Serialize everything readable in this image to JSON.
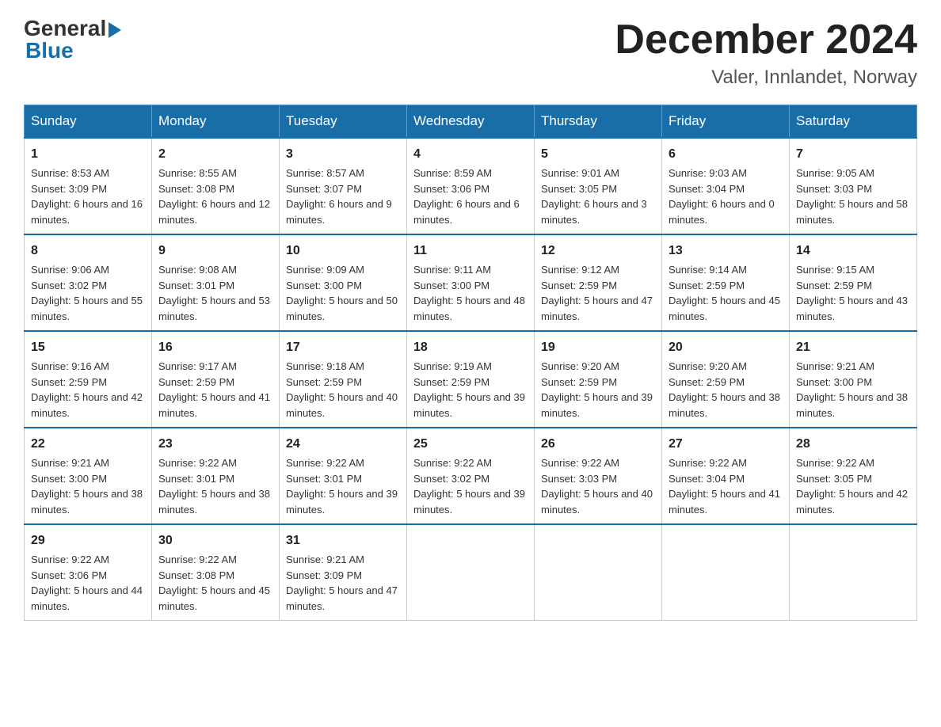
{
  "header": {
    "logo_general": "General",
    "logo_blue": "Blue",
    "month_title": "December 2024",
    "location": "Valer, Innlandet, Norway"
  },
  "days_of_week": [
    "Sunday",
    "Monday",
    "Tuesday",
    "Wednesday",
    "Thursday",
    "Friday",
    "Saturday"
  ],
  "weeks": [
    [
      {
        "day": "1",
        "sunrise": "Sunrise: 8:53 AM",
        "sunset": "Sunset: 3:09 PM",
        "daylight": "Daylight: 6 hours and 16 minutes."
      },
      {
        "day": "2",
        "sunrise": "Sunrise: 8:55 AM",
        "sunset": "Sunset: 3:08 PM",
        "daylight": "Daylight: 6 hours and 12 minutes."
      },
      {
        "day": "3",
        "sunrise": "Sunrise: 8:57 AM",
        "sunset": "Sunset: 3:07 PM",
        "daylight": "Daylight: 6 hours and 9 minutes."
      },
      {
        "day": "4",
        "sunrise": "Sunrise: 8:59 AM",
        "sunset": "Sunset: 3:06 PM",
        "daylight": "Daylight: 6 hours and 6 minutes."
      },
      {
        "day": "5",
        "sunrise": "Sunrise: 9:01 AM",
        "sunset": "Sunset: 3:05 PM",
        "daylight": "Daylight: 6 hours and 3 minutes."
      },
      {
        "day": "6",
        "sunrise": "Sunrise: 9:03 AM",
        "sunset": "Sunset: 3:04 PM",
        "daylight": "Daylight: 6 hours and 0 minutes."
      },
      {
        "day": "7",
        "sunrise": "Sunrise: 9:05 AM",
        "sunset": "Sunset: 3:03 PM",
        "daylight": "Daylight: 5 hours and 58 minutes."
      }
    ],
    [
      {
        "day": "8",
        "sunrise": "Sunrise: 9:06 AM",
        "sunset": "Sunset: 3:02 PM",
        "daylight": "Daylight: 5 hours and 55 minutes."
      },
      {
        "day": "9",
        "sunrise": "Sunrise: 9:08 AM",
        "sunset": "Sunset: 3:01 PM",
        "daylight": "Daylight: 5 hours and 53 minutes."
      },
      {
        "day": "10",
        "sunrise": "Sunrise: 9:09 AM",
        "sunset": "Sunset: 3:00 PM",
        "daylight": "Daylight: 5 hours and 50 minutes."
      },
      {
        "day": "11",
        "sunrise": "Sunrise: 9:11 AM",
        "sunset": "Sunset: 3:00 PM",
        "daylight": "Daylight: 5 hours and 48 minutes."
      },
      {
        "day": "12",
        "sunrise": "Sunrise: 9:12 AM",
        "sunset": "Sunset: 2:59 PM",
        "daylight": "Daylight: 5 hours and 47 minutes."
      },
      {
        "day": "13",
        "sunrise": "Sunrise: 9:14 AM",
        "sunset": "Sunset: 2:59 PM",
        "daylight": "Daylight: 5 hours and 45 minutes."
      },
      {
        "day": "14",
        "sunrise": "Sunrise: 9:15 AM",
        "sunset": "Sunset: 2:59 PM",
        "daylight": "Daylight: 5 hours and 43 minutes."
      }
    ],
    [
      {
        "day": "15",
        "sunrise": "Sunrise: 9:16 AM",
        "sunset": "Sunset: 2:59 PM",
        "daylight": "Daylight: 5 hours and 42 minutes."
      },
      {
        "day": "16",
        "sunrise": "Sunrise: 9:17 AM",
        "sunset": "Sunset: 2:59 PM",
        "daylight": "Daylight: 5 hours and 41 minutes."
      },
      {
        "day": "17",
        "sunrise": "Sunrise: 9:18 AM",
        "sunset": "Sunset: 2:59 PM",
        "daylight": "Daylight: 5 hours and 40 minutes."
      },
      {
        "day": "18",
        "sunrise": "Sunrise: 9:19 AM",
        "sunset": "Sunset: 2:59 PM",
        "daylight": "Daylight: 5 hours and 39 minutes."
      },
      {
        "day": "19",
        "sunrise": "Sunrise: 9:20 AM",
        "sunset": "Sunset: 2:59 PM",
        "daylight": "Daylight: 5 hours and 39 minutes."
      },
      {
        "day": "20",
        "sunrise": "Sunrise: 9:20 AM",
        "sunset": "Sunset: 2:59 PM",
        "daylight": "Daylight: 5 hours and 38 minutes."
      },
      {
        "day": "21",
        "sunrise": "Sunrise: 9:21 AM",
        "sunset": "Sunset: 3:00 PM",
        "daylight": "Daylight: 5 hours and 38 minutes."
      }
    ],
    [
      {
        "day": "22",
        "sunrise": "Sunrise: 9:21 AM",
        "sunset": "Sunset: 3:00 PM",
        "daylight": "Daylight: 5 hours and 38 minutes."
      },
      {
        "day": "23",
        "sunrise": "Sunrise: 9:22 AM",
        "sunset": "Sunset: 3:01 PM",
        "daylight": "Daylight: 5 hours and 38 minutes."
      },
      {
        "day": "24",
        "sunrise": "Sunrise: 9:22 AM",
        "sunset": "Sunset: 3:01 PM",
        "daylight": "Daylight: 5 hours and 39 minutes."
      },
      {
        "day": "25",
        "sunrise": "Sunrise: 9:22 AM",
        "sunset": "Sunset: 3:02 PM",
        "daylight": "Daylight: 5 hours and 39 minutes."
      },
      {
        "day": "26",
        "sunrise": "Sunrise: 9:22 AM",
        "sunset": "Sunset: 3:03 PM",
        "daylight": "Daylight: 5 hours and 40 minutes."
      },
      {
        "day": "27",
        "sunrise": "Sunrise: 9:22 AM",
        "sunset": "Sunset: 3:04 PM",
        "daylight": "Daylight: 5 hours and 41 minutes."
      },
      {
        "day": "28",
        "sunrise": "Sunrise: 9:22 AM",
        "sunset": "Sunset: 3:05 PM",
        "daylight": "Daylight: 5 hours and 42 minutes."
      }
    ],
    [
      {
        "day": "29",
        "sunrise": "Sunrise: 9:22 AM",
        "sunset": "Sunset: 3:06 PM",
        "daylight": "Daylight: 5 hours and 44 minutes."
      },
      {
        "day": "30",
        "sunrise": "Sunrise: 9:22 AM",
        "sunset": "Sunset: 3:08 PM",
        "daylight": "Daylight: 5 hours and 45 minutes."
      },
      {
        "day": "31",
        "sunrise": "Sunrise: 9:21 AM",
        "sunset": "Sunset: 3:09 PM",
        "daylight": "Daylight: 5 hours and 47 minutes."
      },
      null,
      null,
      null,
      null
    ]
  ]
}
